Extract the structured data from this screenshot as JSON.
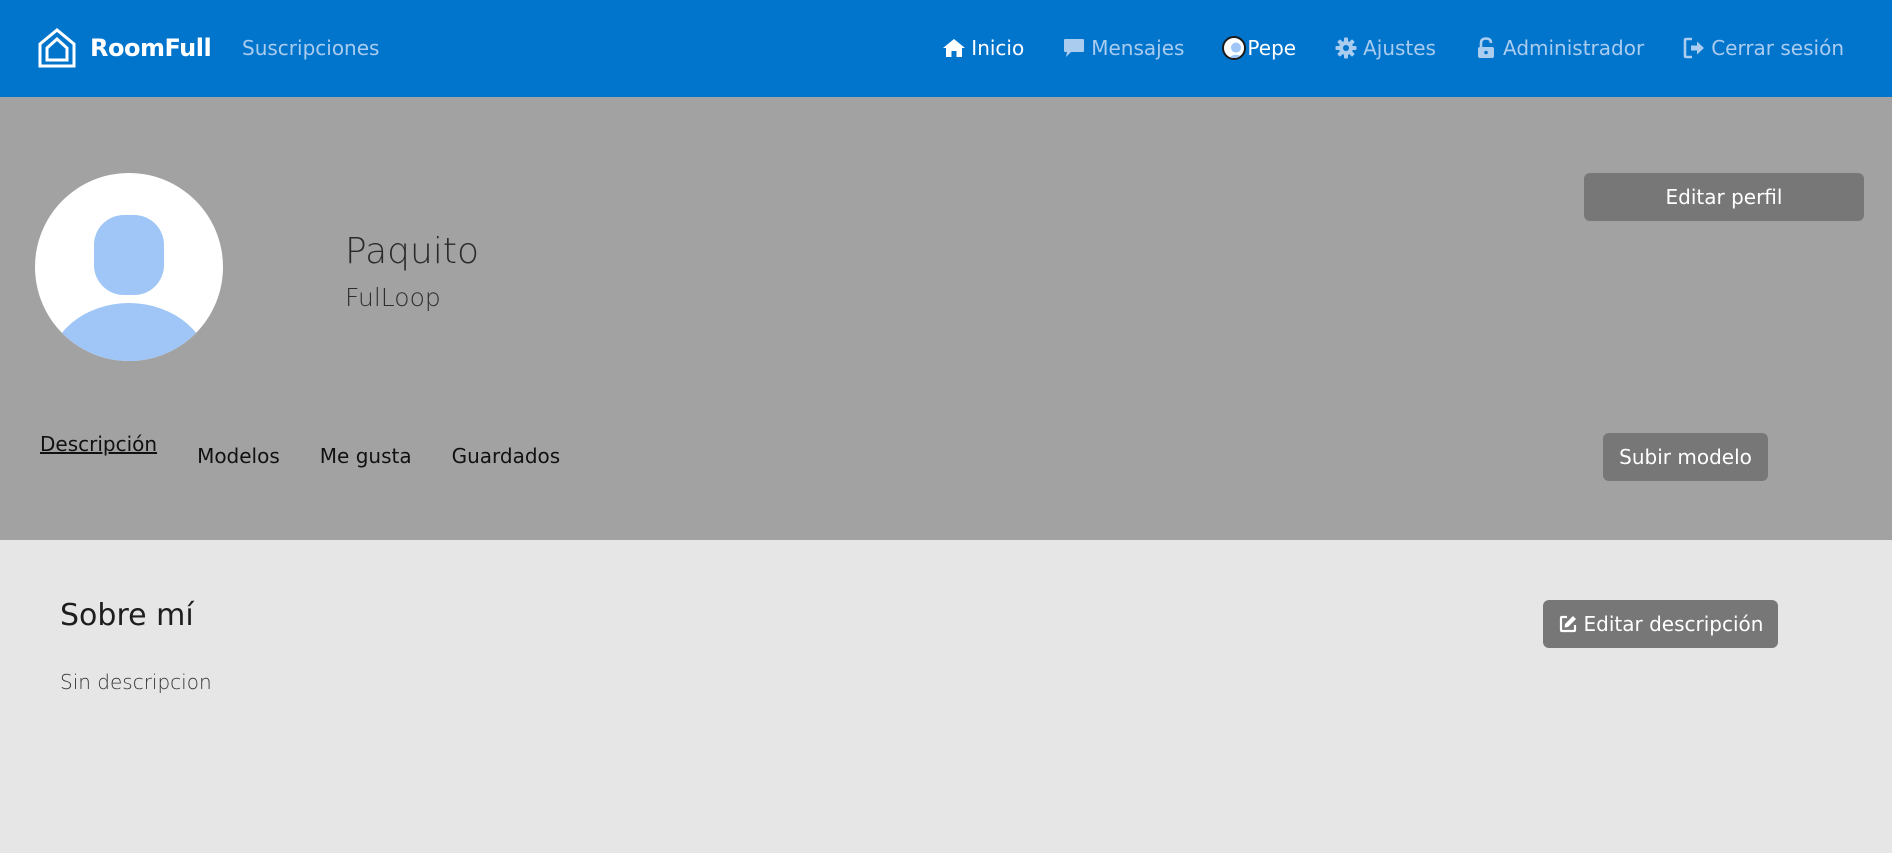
{
  "brand": {
    "name": "RoomFull",
    "logo_icon": "house-logo-icon"
  },
  "nav": {
    "subscriptions": "Suscripciones",
    "items": [
      {
        "label": "Inicio",
        "icon": "home-icon",
        "active": true
      },
      {
        "label": "Mensajes",
        "icon": "chat-icon",
        "active": false
      },
      {
        "label": "Pepe",
        "icon": "user-avatar",
        "active": true
      },
      {
        "label": "Ajustes",
        "icon": "gear-icon",
        "active": false
      },
      {
        "label": "Administrador",
        "icon": "unlock-icon",
        "active": false
      },
      {
        "label": "Cerrar sesión",
        "icon": "sign-out-icon",
        "active": false
      }
    ]
  },
  "profile": {
    "name": "Paquito",
    "subtitle": "FulLoop",
    "edit_profile": "Editar perfil",
    "upload_model": "Subir modelo"
  },
  "tabs": [
    "Descripción",
    "Modelos",
    "Me gusta",
    "Guardados"
  ],
  "about": {
    "title": "Sobre mí",
    "text": "Sin descripcion",
    "edit_button": "Editar descripción"
  },
  "colors": {
    "navbar": "#0174cc",
    "nav_link": "#a9ccef",
    "header_bg": "#a2a2a2",
    "button_bg": "#777777",
    "avatar_accent": "#9fc6f6",
    "page_bg": "#e6e6e6"
  }
}
